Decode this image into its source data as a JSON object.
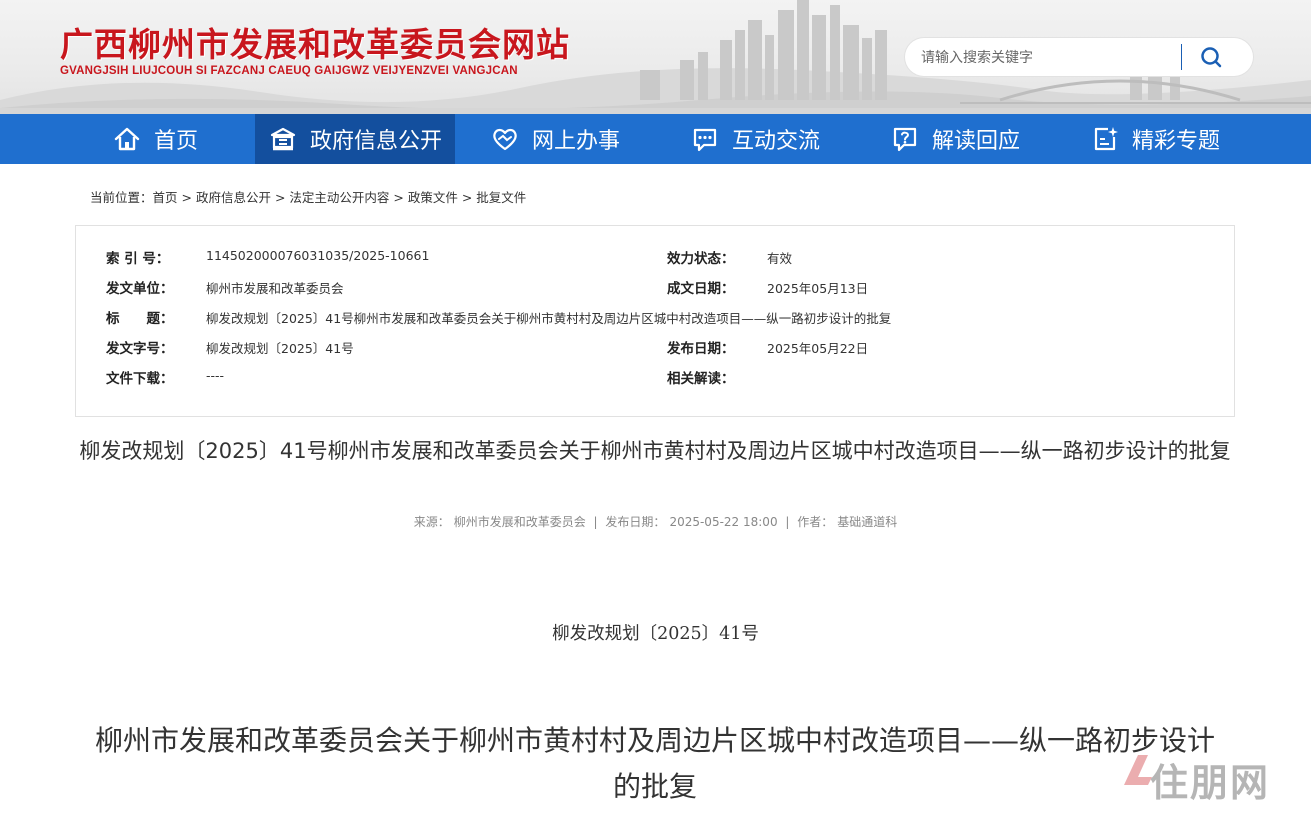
{
  "header": {
    "site_title": "广西柳州市发展和改革委员会网站",
    "site_subtitle": "GVANGJSIH LIUJCOUH SI FAZCANJ CAEUQ GAIJGWZ VEIJYENZVEI VANGJCAN",
    "search_placeholder": "请输入搜索关键字"
  },
  "nav": {
    "items": [
      {
        "label": "首页",
        "icon": "home-icon"
      },
      {
        "label": "政府信息公开",
        "icon": "government-building-icon",
        "active": true
      },
      {
        "label": "网上办事",
        "icon": "handshake-heart-icon"
      },
      {
        "label": "互动交流",
        "icon": "chat-bubble-icon"
      },
      {
        "label": "解读回应",
        "icon": "question-bubble-icon"
      },
      {
        "label": "精彩专题",
        "icon": "sparkle-document-icon"
      }
    ]
  },
  "breadcrumb": {
    "prefix": "当前位置：",
    "items": [
      "首页",
      "政府信息公开",
      "法定主动公开内容",
      "政策文件",
      "批复文件"
    ],
    "separator": " > "
  },
  "info": {
    "index_label": "索 引 号：",
    "index_value": "114502000076031035/2025-10661",
    "status_label": "效力状态：",
    "status_value": "有效",
    "issuer_label": "发文单位：",
    "issuer_value": "柳州市发展和改革委员会",
    "created_label": "成文日期：",
    "created_value": "2025年05月13日",
    "title_label": "标　　题：",
    "title_value": "柳发改规划〔2025〕41号柳州市发展和改革委员会关于柳州市黄村村及周边片区城中村改造项目——纵一路初步设计的批复",
    "docno_label": "发文字号：",
    "docno_value": "柳发改规划〔2025〕41号",
    "published_label": "发布日期：",
    "published_value": "2025年05月22日",
    "download_label": "文件下载：",
    "download_value": "----",
    "related_label": "相关解读："
  },
  "article": {
    "title": "柳发改规划〔2025〕41号柳州市发展和改革委员会关于柳州市黄村村及周边片区城中村改造项目——纵一路初步设计的批复",
    "source_label": "来源：",
    "source_value": "柳州市发展和改革委员会",
    "date_label": "发布日期：",
    "date_value": "2025-05-22 18:00",
    "author_label": "作者：",
    "author_value": "基础通道科",
    "doc_number": "柳发改规划〔2025〕41号",
    "doc_heading": "柳州市发展和改革委员会关于柳州市黄村村及周边片区城中村改造项目——纵一路初步设计的批复"
  },
  "watermark": {
    "logo_text": "住朋网"
  },
  "colors": {
    "brand_red": "#c8161d",
    "nav_blue": "#1f6fcf",
    "nav_active": "#134f9e"
  }
}
